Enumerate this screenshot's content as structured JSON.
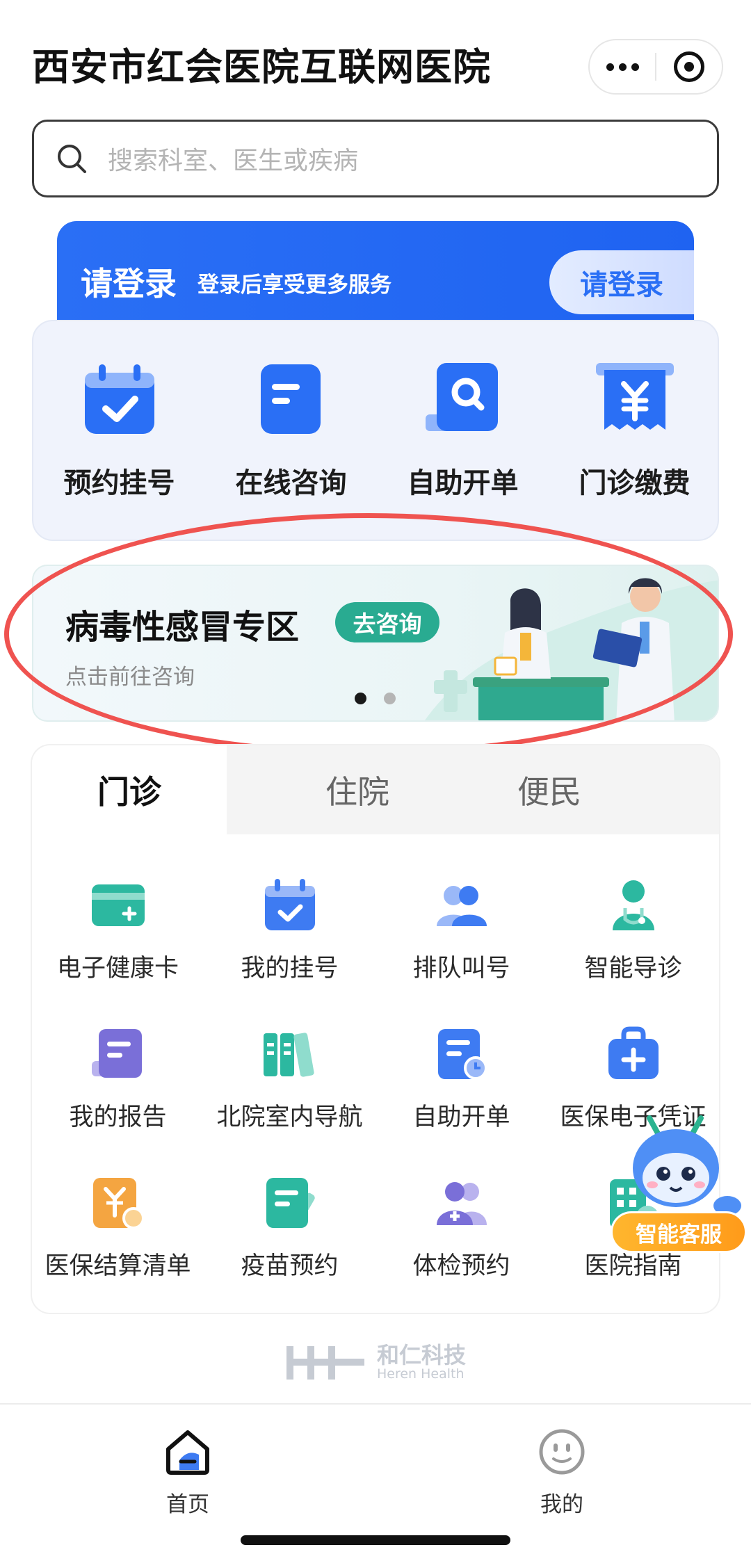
{
  "header": {
    "title": "西安市红会医院互联网医院"
  },
  "search": {
    "placeholder": "搜索科室、医生或疾病"
  },
  "login_banner": {
    "title": "请登录",
    "subtitle": "登录后享受更多服务",
    "button": "请登录"
  },
  "quick_actions": [
    {
      "label": "预约挂号",
      "icon": "calendar-check-icon"
    },
    {
      "label": "在线咨询",
      "icon": "chat-document-icon"
    },
    {
      "label": "自助开单",
      "icon": "document-search-icon"
    },
    {
      "label": "门诊缴费",
      "icon": "yuan-receipt-icon"
    }
  ],
  "promo": {
    "title": "病毒性感冒专区",
    "button": "去咨询",
    "subtitle": "点击前往咨询",
    "slides": 2,
    "active_slide": 1
  },
  "tabs": [
    {
      "label": "门诊",
      "active": true
    },
    {
      "label": "住院",
      "active": false
    },
    {
      "label": "便民",
      "active": false
    }
  ],
  "services": [
    {
      "label": "电子健康卡",
      "icon": "health-card-icon",
      "color": "#2cb8a0"
    },
    {
      "label": "我的挂号",
      "icon": "calendar-check-icon",
      "color": "#3e7bf2"
    },
    {
      "label": "排队叫号",
      "icon": "people-queue-icon",
      "color": "#3e7bf2"
    },
    {
      "label": "智能导诊",
      "icon": "doctor-icon",
      "color": "#2cb8a0"
    },
    {
      "label": "我的报告",
      "icon": "report-icon",
      "color": "#7a6fd8"
    },
    {
      "label": "北院室内导航",
      "icon": "book-navigation-icon",
      "color": "#2cb8a0"
    },
    {
      "label": "自助开单",
      "icon": "document-clock-icon",
      "color": "#3e7bf2"
    },
    {
      "label": "医保电子凭证",
      "icon": "medical-bag-icon",
      "color": "#3e7bf2"
    },
    {
      "label": "医保结算清单",
      "icon": "yuan-bill-icon",
      "color": "#f4a541"
    },
    {
      "label": "疫苗预约",
      "icon": "vaccine-note-icon",
      "color": "#2cb8a0"
    },
    {
      "label": "体检预约",
      "icon": "checkup-person-icon",
      "color": "#7a6fd8"
    },
    {
      "label": "医院指南",
      "icon": "building-guide-icon",
      "color": "#2cb8a0"
    }
  ],
  "assistant": {
    "label": "智能客服"
  },
  "brand": {
    "name": "和仁科技",
    "sub": "Heren Health"
  },
  "bottom_nav": [
    {
      "label": "首页",
      "icon": "home-icon",
      "active": true
    },
    {
      "label": "我的",
      "icon": "profile-face-icon",
      "active": false
    }
  ]
}
